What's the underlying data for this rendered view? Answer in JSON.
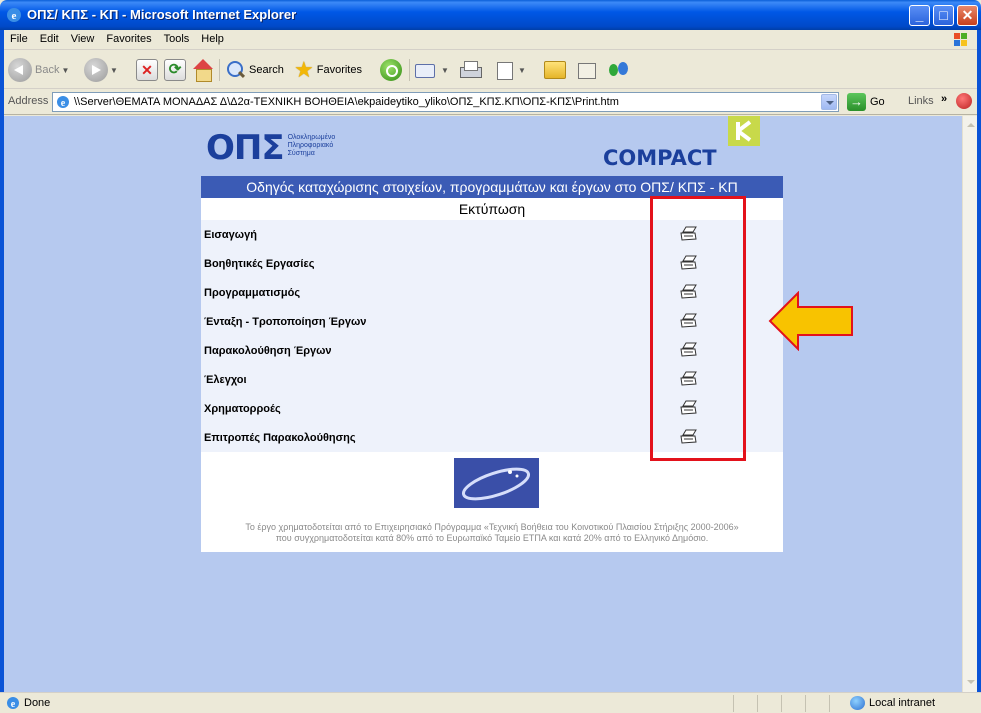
{
  "window": {
    "title": "ΟΠΣ/ ΚΠΣ - ΚΠ - Microsoft Internet Explorer"
  },
  "menu": [
    "File",
    "Edit",
    "View",
    "Favorites",
    "Tools",
    "Help"
  ],
  "toolbar": {
    "back_label": "Back",
    "search_label": "Search",
    "favorites_label": "Favorites"
  },
  "address": {
    "label": "Address",
    "url": "\\\\Server\\ΘΕΜΑΤΑ ΜΟΝΑΔΑΣ Δ\\Δ2α-ΤΕΧΝΙΚΗ ΒΟΗΘΕΙΑ\\ekpaideytiko_yliko\\ΟΠΣ_ΚΠΣ.ΚΠ\\ΟΠΣ-ΚΠΣ\\Print.htm",
    "go_label": "Go",
    "links_label": "Links",
    "links_chevron": "»"
  },
  "page": {
    "logo_letters": "ΟΠΣ",
    "logo_tagline": [
      "Ολοκληρωμένο",
      "Πληροφοριακό",
      "Σύστημα"
    ],
    "compact_label": "COMPACT",
    "nav_title": "Οδηγός καταχώρισης στοιχείων, προγραμμάτων και έργων στο ΟΠΣ/ ΚΠΣ - ΚΠ",
    "section_title": "Εκτύπωση",
    "items": [
      {
        "label": "Εισαγωγή"
      },
      {
        "label": "Βοηθητικές Εργασίες"
      },
      {
        "label": "Προγραμματισμός"
      },
      {
        "label": "Ένταξη - Τροποποίηση Έργων"
      },
      {
        "label": "Παρακολούθηση Έργων"
      },
      {
        "label": "Έλεγχοι"
      },
      {
        "label": "Χρηματορροές"
      },
      {
        "label": "Επιτροπές Παρακολούθησης"
      }
    ],
    "funding_note_line1": "Το έργο χρηματοδοτείται από το Επιχειρησιακό Πρόγραμμα «Τεχνική Βοήθεια του Κοινοτικού Πλαισίου Στήριξης 2000-2006»",
    "funding_note_line2": "που συγχρηματοδοτείται κατά 80% από το Ευρωπαϊκό Ταμείο ΕΤΠΑ και κατά 20% από το Ελληνικό Δημόσιο."
  },
  "status": {
    "text": "Done",
    "zone": "Local intranet"
  },
  "colors": {
    "page_bg": "#b6c9ef",
    "nav_bg": "#3b5bb5",
    "highlight_red": "#e3121b",
    "arrow_yellow": "#f8c300"
  }
}
